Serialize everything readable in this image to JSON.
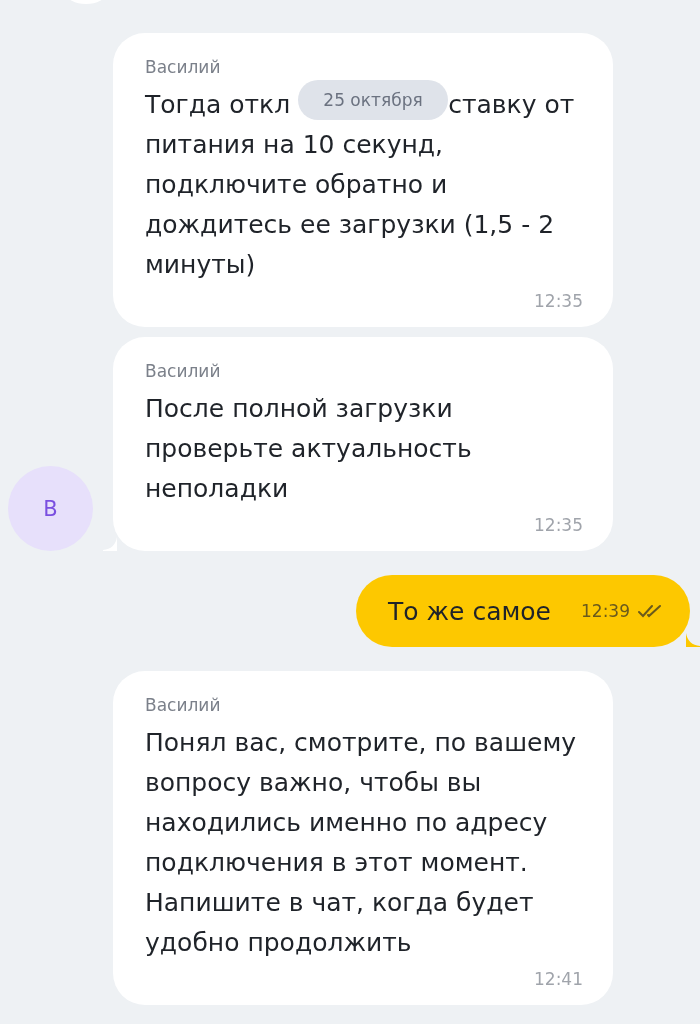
{
  "date_badge": "25 октября",
  "messages": [
    {
      "kind": "incoming",
      "sender": "Василий",
      "text_start": "Тогда откл",
      "text_end": "ставку от",
      "text": "питания на 10 секунд, подключите обратно и дождитесь ее загрузки (1,5 - 2 минуты)",
      "time": "12:35",
      "tail": false
    },
    {
      "kind": "incoming",
      "sender": "Василий",
      "text": "После полной загрузки проверьте актуальность неполадки",
      "time": "12:35",
      "tail": true,
      "avatar": "В"
    },
    {
      "kind": "outgoing",
      "text": "То же самое",
      "time": "12:39",
      "read": true,
      "tail": true
    },
    {
      "kind": "incoming",
      "sender": "Василий",
      "text": "Понял вас, смотрите, по вашему вопросу важно, чтобы вы находились именно по адресу подключения в этот момент. Напишите в чат, когда будет удобно продолжить",
      "time": "12:41",
      "tail": false
    }
  ]
}
